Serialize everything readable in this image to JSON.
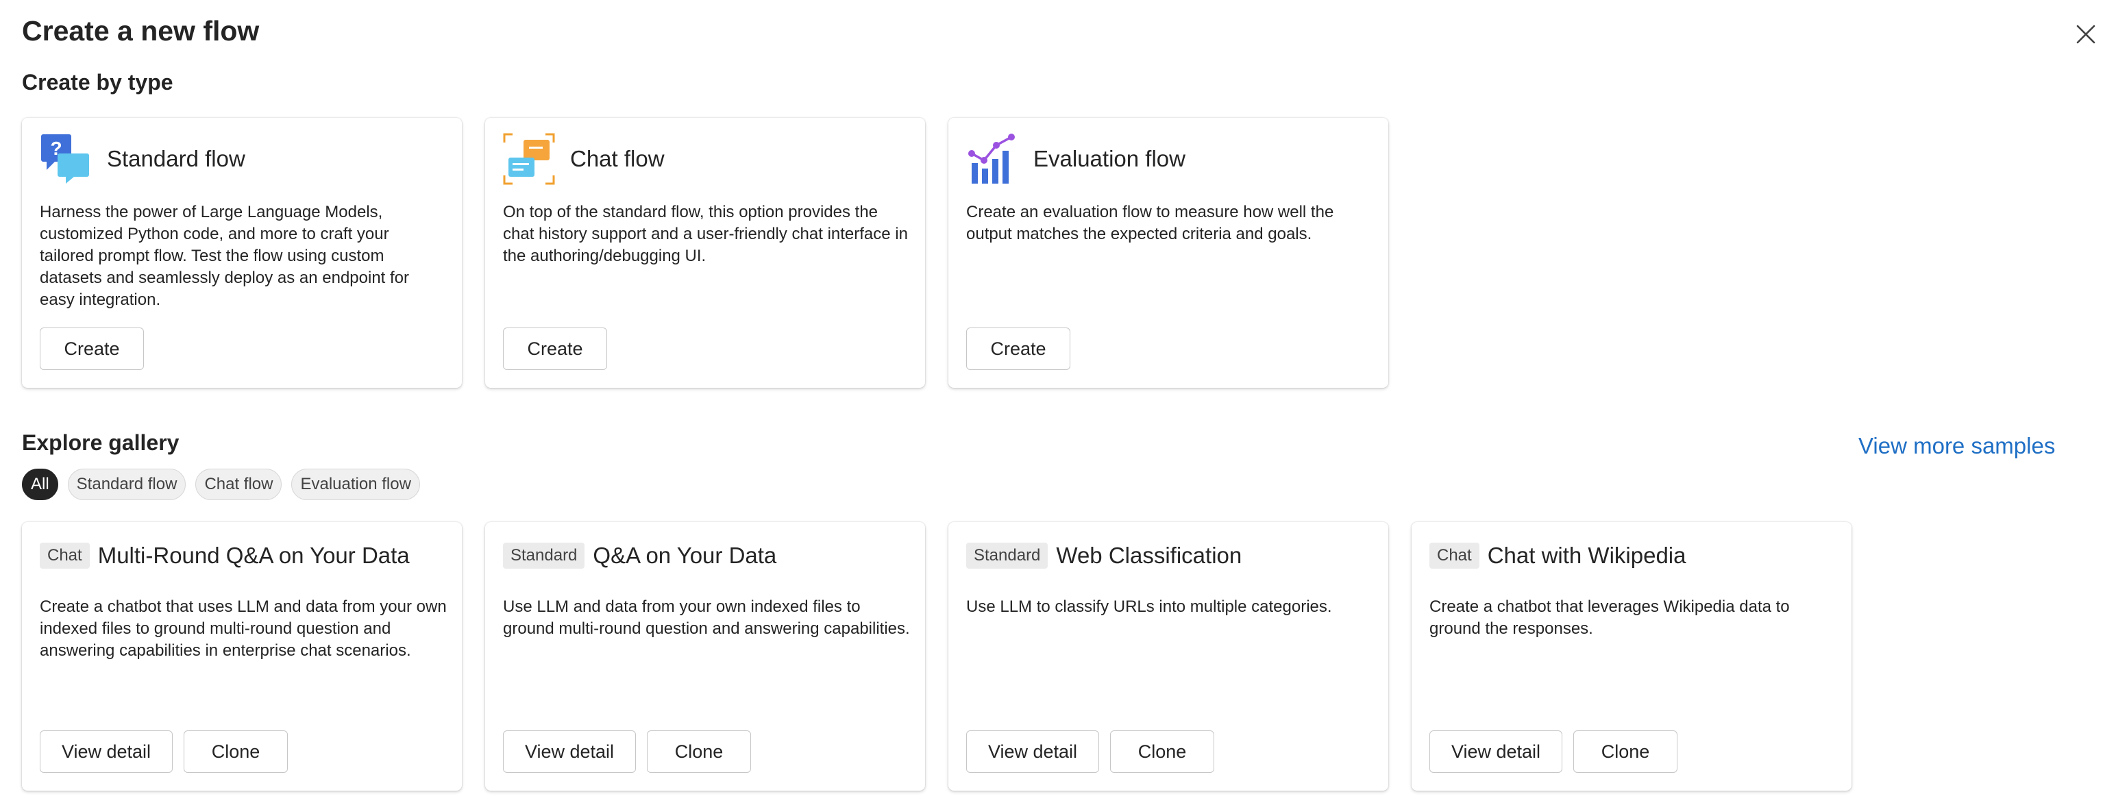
{
  "header": {
    "title": "Create a new flow",
    "close_icon": "close-icon"
  },
  "create_by_type": {
    "section_title": "Create by type",
    "cards": [
      {
        "icon": "standard-flow-icon",
        "title": "Standard flow",
        "description": "Harness the power of Large Language Models, customized Python code, and more to craft your tailored prompt flow. Test the flow using custom datasets and seamlessly deploy as an endpoint for easy integration.",
        "button_label": "Create"
      },
      {
        "icon": "chat-flow-icon",
        "title": "Chat flow",
        "description": "On top of the standard flow, this option provides the chat history support and a user-friendly chat interface in the authoring/debugging UI.",
        "button_label": "Create"
      },
      {
        "icon": "evaluation-flow-icon",
        "title": "Evaluation flow",
        "description": "Create an evaluation flow to measure how well the output matches the expected criteria and goals.",
        "button_label": "Create"
      }
    ]
  },
  "gallery": {
    "section_title": "Explore gallery",
    "view_more_label": "View more samples",
    "filters": [
      {
        "label": "All",
        "active": true
      },
      {
        "label": "Standard flow",
        "active": false
      },
      {
        "label": "Chat flow",
        "active": false
      },
      {
        "label": "Evaluation flow",
        "active": false
      }
    ],
    "cards": [
      {
        "tag": "Chat",
        "title": "Multi-Round Q&A on Your Data",
        "description": "Create a chatbot that uses LLM and data from your own indexed files to ground multi-round question and answering capabilities in enterprise chat scenarios.",
        "detail_label": "View detail",
        "clone_label": "Clone"
      },
      {
        "tag": "Standard",
        "title": "Q&A on Your Data",
        "description": "Use LLM and data from your own indexed files to ground multi-round question and answering capabilities.",
        "detail_label": "View detail",
        "clone_label": "Clone"
      },
      {
        "tag": "Standard",
        "title": "Web Classification",
        "description": "Use LLM to classify URLs into multiple categories.",
        "detail_label": "View detail",
        "clone_label": "Clone"
      },
      {
        "tag": "Chat",
        "title": "Chat with Wikipedia",
        "description": "Create a chatbot that leverages Wikipedia data to ground the responses.",
        "detail_label": "View detail",
        "clone_label": "Clone"
      }
    ]
  },
  "colors": {
    "link": "#1f6fc5",
    "active_pill": "#242424",
    "text": "#242424",
    "button_border": "#c7c7c7"
  }
}
